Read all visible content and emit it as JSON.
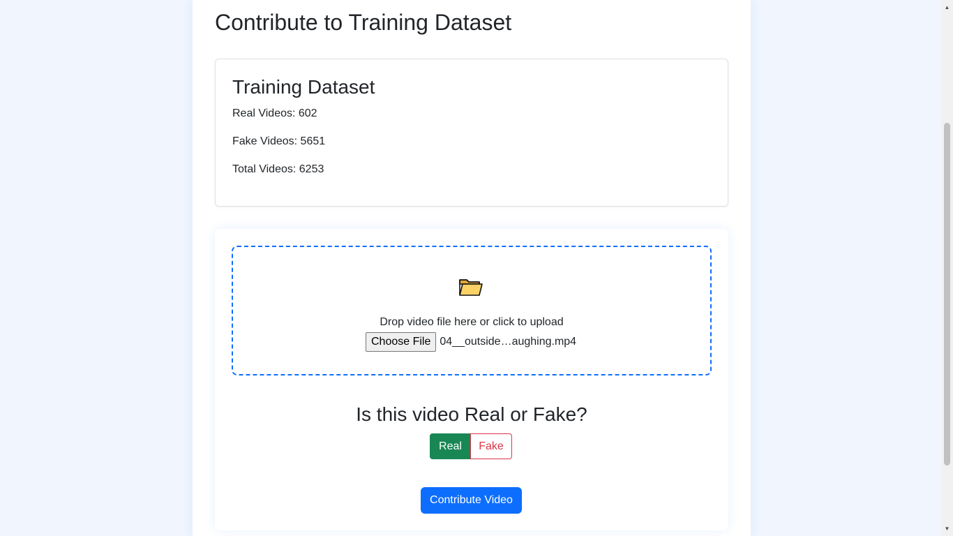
{
  "page": {
    "title": "Contribute to Training Dataset"
  },
  "stats": {
    "title": "Training Dataset",
    "real": "Real Videos: 602",
    "fake": "Fake Videos: 5651",
    "total": "Total Videos: 6253"
  },
  "upload": {
    "icon": "folder-icon",
    "instruction": "Drop video file here or click to upload",
    "choose_label": "Choose File",
    "file_name": "04__outside…aughing.mp4"
  },
  "classification": {
    "question": "Is this video Real or Fake?",
    "real_label": "Real",
    "fake_label": "Fake",
    "selected": "Real"
  },
  "submit": {
    "label": "Contribute Video"
  },
  "colors": {
    "primary": "#0d6efd",
    "success": "#198754",
    "danger": "#dc3545"
  }
}
